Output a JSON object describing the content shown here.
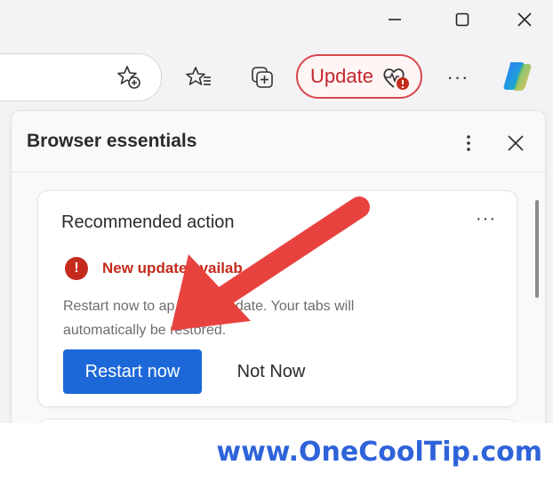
{
  "titlebar": {
    "minimize_icon": "minimize-icon",
    "maximize_icon": "maximize-icon",
    "close_icon": "close-icon"
  },
  "toolbar": {
    "update_label": "Update",
    "more_label": "···"
  },
  "panel": {
    "title": "Browser essentials",
    "card": {
      "title": "Recommended action",
      "more_label": "···",
      "alert_mark": "!",
      "alert_text": "New update availab",
      "body_line1": "Restart now to ap latest update. Your tabs will",
      "body_line2": "automatically be restored.",
      "restart_label": "Restart now",
      "not_now_label": "Not Now"
    }
  },
  "watermark": "www.OneCoolTip.com",
  "colors": {
    "accent_blue": "#1c68d8",
    "alert_red": "#c42b1c",
    "update_red": "#d8474b",
    "arrow_red": "#e8423f",
    "watermark_blue": "#2f63d9"
  }
}
